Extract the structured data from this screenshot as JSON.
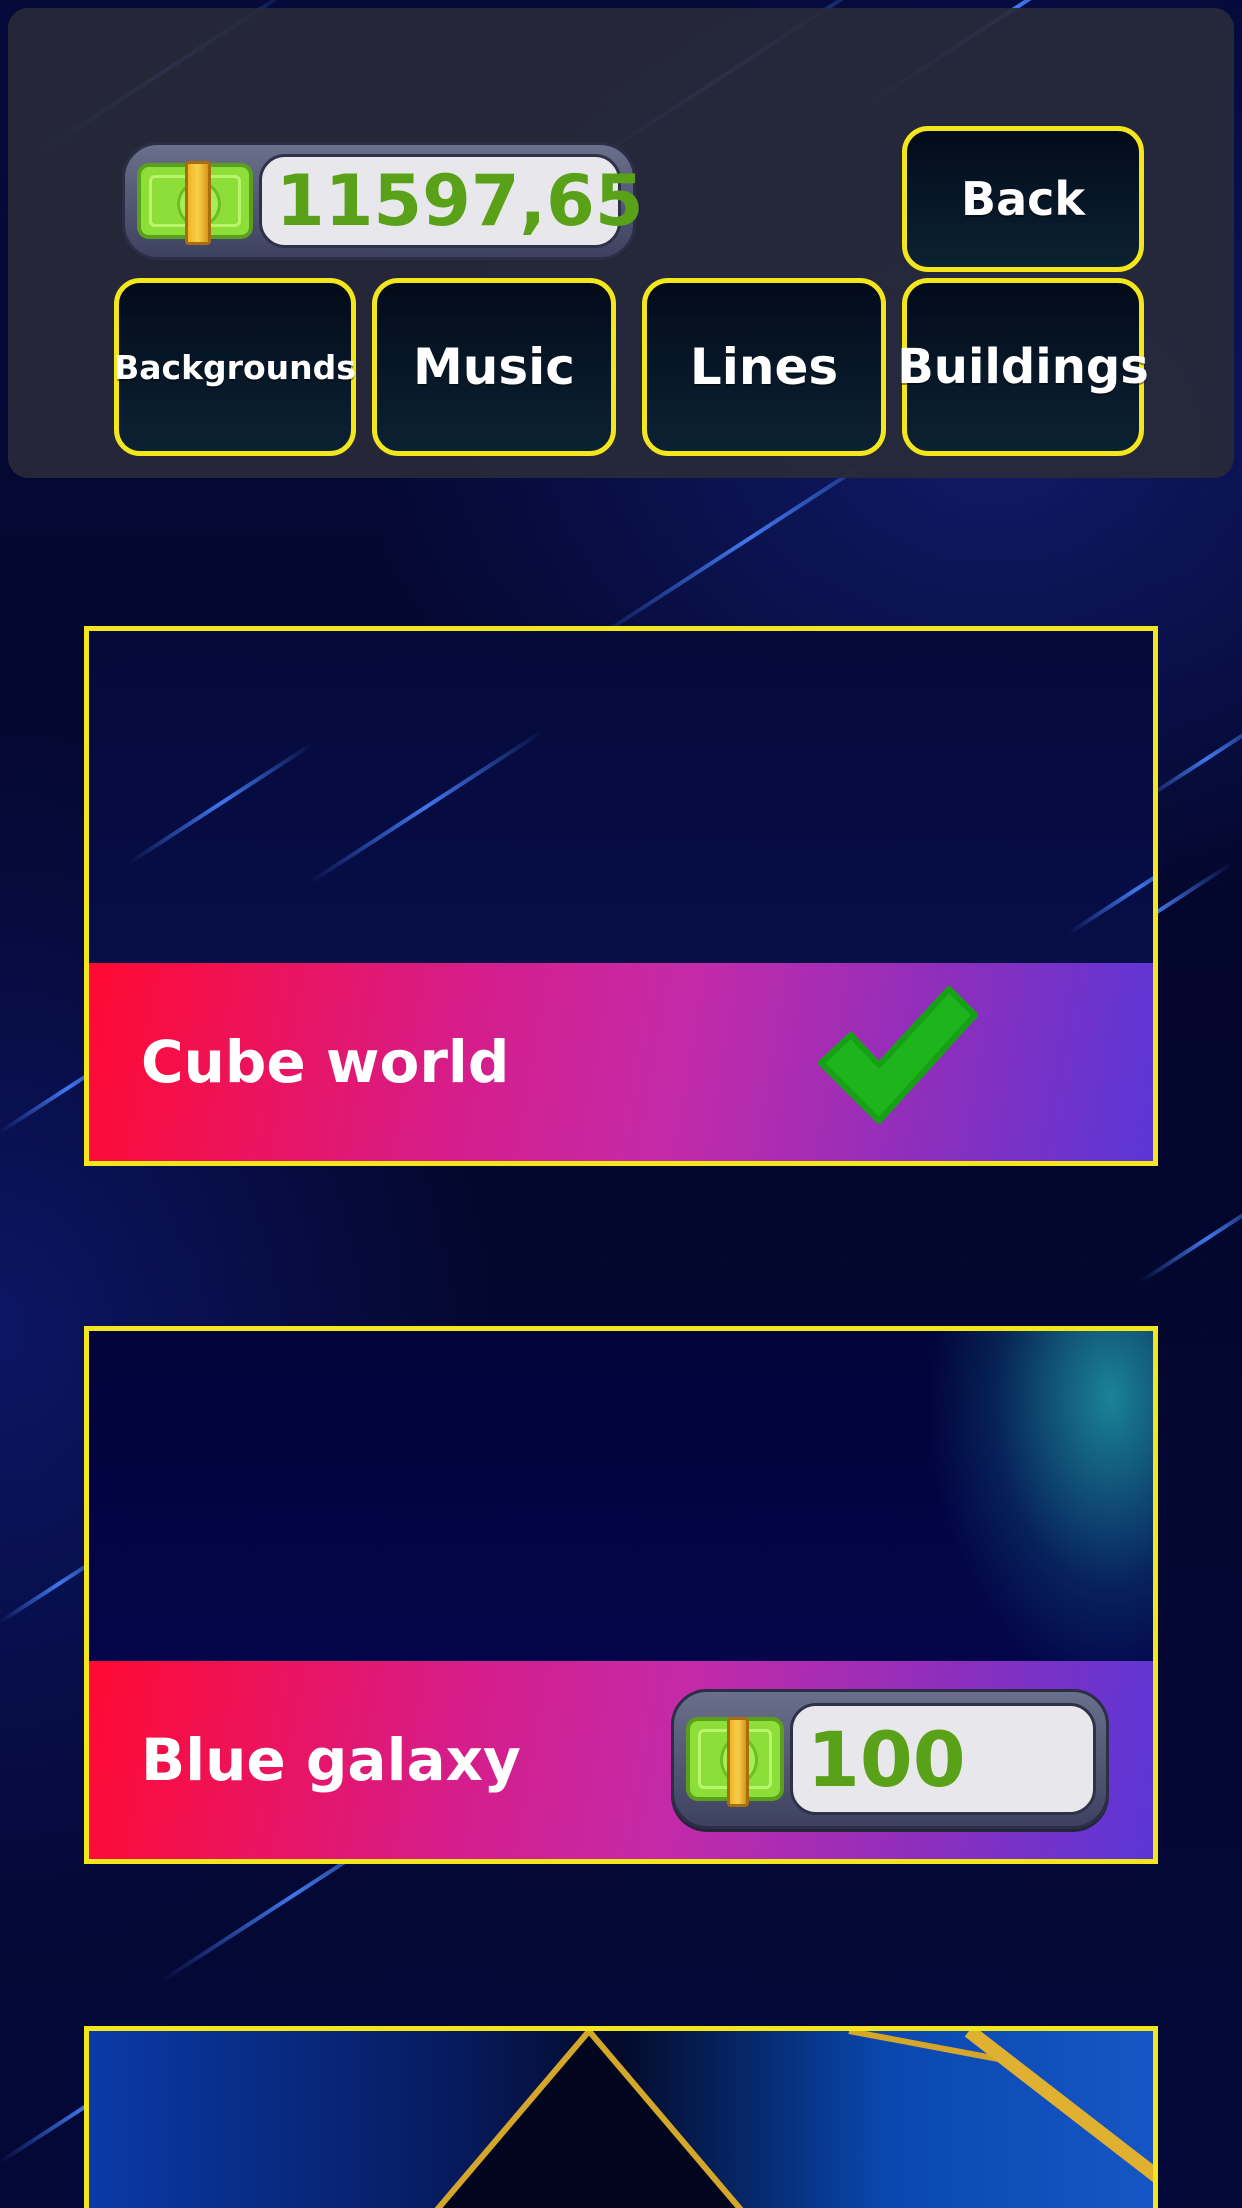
{
  "header": {
    "balance": "11597,65",
    "back_label": "Back",
    "tabs": [
      "Backgrounds",
      "Music",
      "Lines",
      "Buildings"
    ]
  },
  "items": [
    {
      "name": "Cube world",
      "status": "owned"
    },
    {
      "name": "Blue galaxy",
      "status": "for-sale",
      "price": "100"
    },
    {
      "name": "",
      "status": "partially-visible"
    }
  ],
  "colors": {
    "button_border": "#f4e61c",
    "money_text": "#5aa11a",
    "check": "#1db51b"
  },
  "icons": {
    "money": "cash-stack-icon",
    "owned": "checkmark-icon"
  }
}
